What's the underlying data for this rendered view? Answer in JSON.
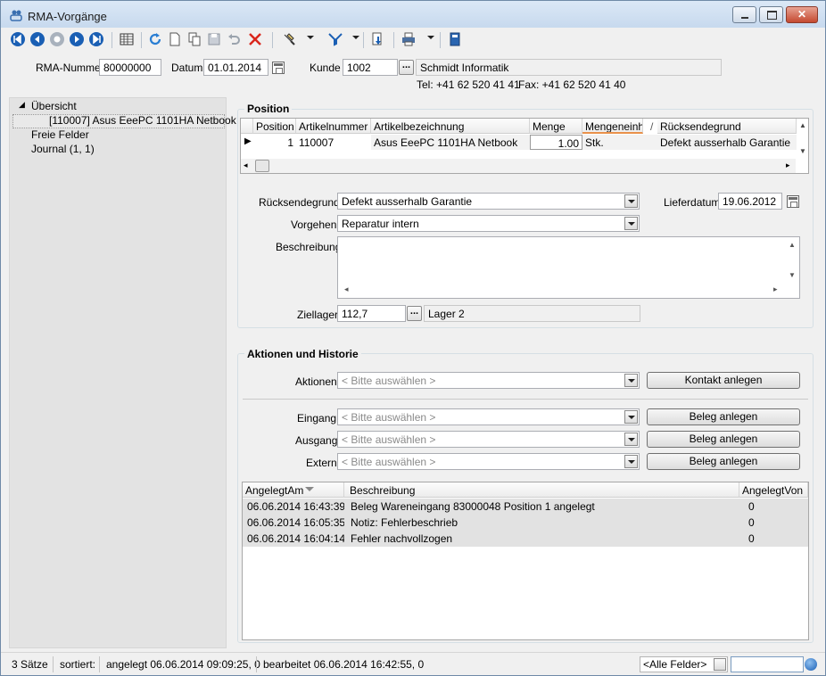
{
  "window": {
    "title": "RMA-Vorgänge"
  },
  "toolbar": {
    "icons": [
      "first-icon",
      "previous-icon",
      "stop-icon",
      "next-icon",
      "last-icon",
      "list-view-icon",
      "refresh-icon",
      "new-icon",
      "copy-icon",
      "save-icon",
      "undo-icon",
      "delete-icon",
      "search-icon",
      "filter-icon",
      "attachment-icon",
      "print-icon",
      "book-icon"
    ],
    "colors": {
      "nav": "#1a5fb4",
      "delete": "#d9261c",
      "refresh": "#2a7ed3"
    }
  },
  "header": {
    "rma_label": "RMA-Nummer",
    "rma_value": "80000000",
    "datum_label": "Datum",
    "datum_value": "01.01.2014",
    "kunde_label": "Kunde",
    "kunde_value": "1002",
    "kunde_name": "Schmidt Informatik",
    "tel": "Tel: +41 62 520 41 41",
    "fax": "Fax: +41 62 520 41 40"
  },
  "tree": {
    "root": "Übersicht",
    "items": [
      "[110007]  Asus EeePC 1101HA Netbook",
      "Freie Felder",
      "Journal (1, 1)"
    ]
  },
  "position": {
    "title": "Position",
    "columns": [
      "Position",
      "Artikelnummer",
      "Artikelbezeichnung",
      "Menge",
      "Mengeneinheit",
      "Rücksendegrund"
    ],
    "rows": [
      {
        "position": "1",
        "artikelnummer": "110007",
        "artikelbezeichnung": "Asus EeePC 1101HA Netbook",
        "menge": "1.00",
        "einheit": "Stk.",
        "grund": "Defekt ausserhalb Garantie"
      }
    ],
    "sort_indicator": "/"
  },
  "details": {
    "ruecksendegrund_label": "Rücksendegrund",
    "ruecksendegrund_value": "Defekt ausserhalb Garantie",
    "lieferdatum_label": "Lieferdatum",
    "lieferdatum_value": "19.06.2012",
    "vorgehen_label": "Vorgehen",
    "vorgehen_value": "Reparatur intern",
    "beschreibung_label": "Beschreibung",
    "beschreibung_value": "",
    "ziellager_label": "Ziellager",
    "ziellager_value": "112,7",
    "ziellager_name": "Lager 2"
  },
  "aktionen": {
    "title": "Aktionen und Historie",
    "aktionen_label": "Aktionen",
    "placeholder": "< Bitte auswählen >",
    "kontakt_button": "Kontakt anlegen",
    "eingang_label": "Eingang",
    "ausgang_label": "Ausgang",
    "extern_label": "Extern",
    "beleg_button": "Beleg anlegen"
  },
  "history": {
    "columns": [
      "AngelegtAm",
      "Beschreibung",
      "AngelegtVon"
    ],
    "rows": [
      {
        "am": "06.06.2014 16:43:39",
        "beschreibung": "Beleg Wareneingang 83000048 Position 1 angelegt",
        "von": "0"
      },
      {
        "am": "06.06.2014 16:05:35",
        "beschreibung": "Notiz: Fehlerbeschrieb",
        "von": "0"
      },
      {
        "am": "06.06.2014 16:04:14",
        "beschreibung": "Fehler nachvollzogen",
        "von": "0"
      }
    ]
  },
  "status": {
    "count": "3 Sätze",
    "sortiert": "sortiert:",
    "angelegt": "angelegt 06.06.2014 09:09:25,  0",
    "bearbeitet": "bearbeitet 06.06.2014 16:42:55,  0",
    "filter_value": "<Alle Felder>"
  }
}
